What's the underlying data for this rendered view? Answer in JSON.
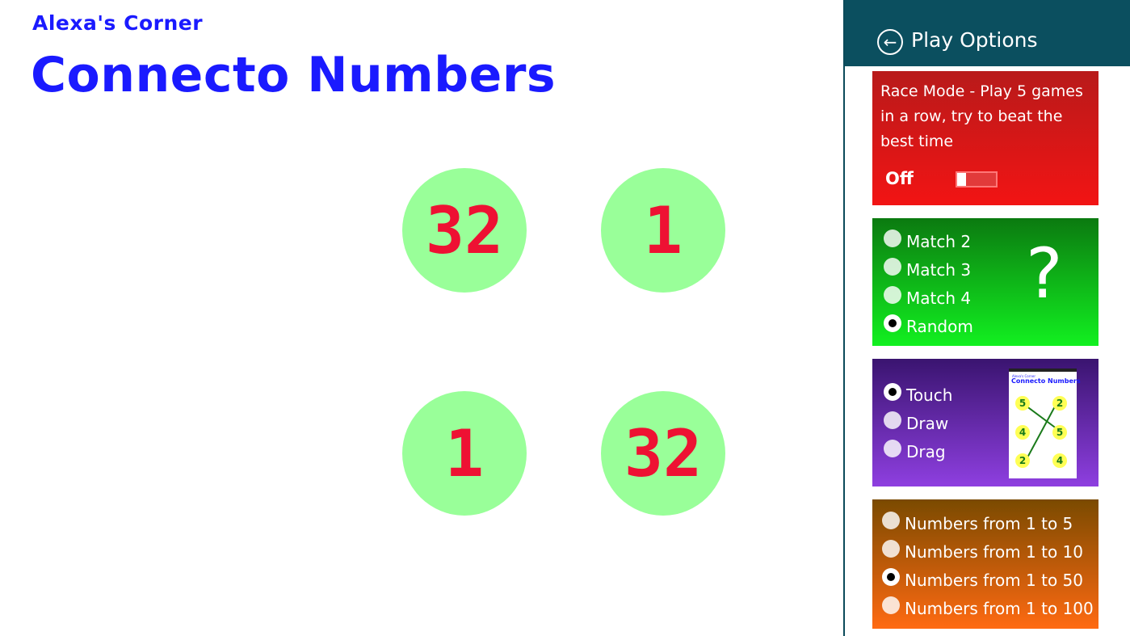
{
  "header": {
    "brand": "Alexa's Corner",
    "title": "Connecto Numbers"
  },
  "game": {
    "balls": [
      "32",
      "1",
      "1",
      "32"
    ],
    "ball_color": "#99ff99",
    "number_color": "#ee1133"
  },
  "panel": {
    "title": "Play Options",
    "back_icon": "back-arrow-icon",
    "race": {
      "text": "Race Mode - Play 5 games in a row, try to beat the best time",
      "state": "Off",
      "enabled": false
    },
    "match": {
      "options": [
        "Match 2",
        "Match 3",
        "Match 4",
        "Random"
      ],
      "selected": "Random",
      "help_glyph": "?"
    },
    "mode": {
      "options": [
        "Touch",
        "Draw",
        "Drag"
      ],
      "selected": "Touch",
      "preview": {
        "brand": "Alexa's Corner",
        "title": "Connecto Numbers",
        "numbers": [
          "5",
          "2",
          "4",
          "5",
          "2",
          "4"
        ]
      }
    },
    "range": {
      "options": [
        "Numbers from 1 to 5",
        "Numbers from 1 to 10",
        "Numbers from 1 to 50",
        "Numbers from 1 to 100"
      ],
      "selected": "Numbers from 1 to 50"
    }
  },
  "colors": {
    "title_blue": "#1a1aff",
    "panel_header": "#0b4f5f",
    "race_card": "#e21616",
    "match_card": "#12c01c",
    "mode_card": "#6a2ab0",
    "range_card": "#c85a0a"
  }
}
